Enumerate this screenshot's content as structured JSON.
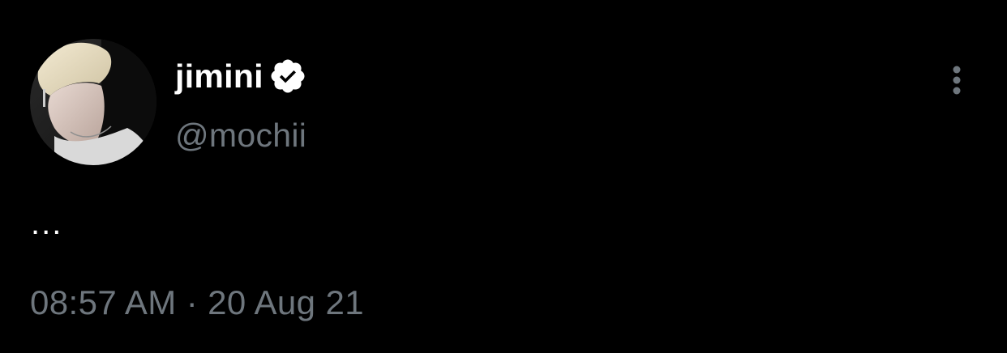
{
  "tweet": {
    "author": {
      "display_name": "jimini",
      "handle": "@mochii",
      "verified": true,
      "avatar": "avatar-photo"
    },
    "text": "...",
    "timestamp": "08:57 AM · 20 Aug 21",
    "more_icon": "more-vertical-icon"
  },
  "colors": {
    "background": "#000000",
    "primary_text": "#ffffff",
    "secondary_text": "#6e767d"
  }
}
